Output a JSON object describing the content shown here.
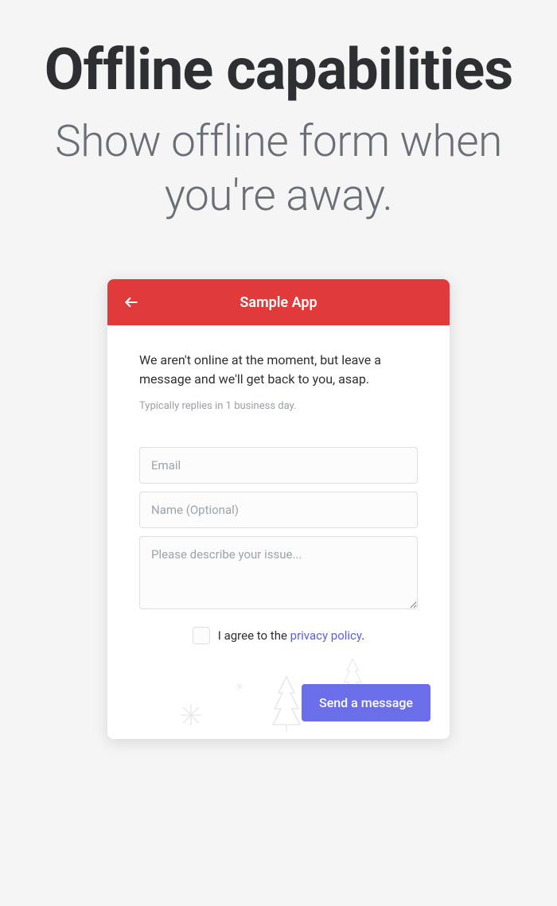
{
  "hero": {
    "title": "Offline capabilities",
    "subtitle": "Show offline form when you're away."
  },
  "chat": {
    "header": {
      "title": "Sample App"
    },
    "body": {
      "offline_message": "We aren't online at the moment, but leave a message and we'll get back to you, asap.",
      "reply_time": "Typically replies in 1 business day.",
      "email_placeholder": "Email",
      "name_placeholder": "Name (Optional)",
      "issue_placeholder": "Please describe your issue...",
      "consent_prefix": "I agree to the ",
      "privacy_link": "privacy policy",
      "consent_suffix": ".",
      "send_button": "Send a message"
    }
  }
}
